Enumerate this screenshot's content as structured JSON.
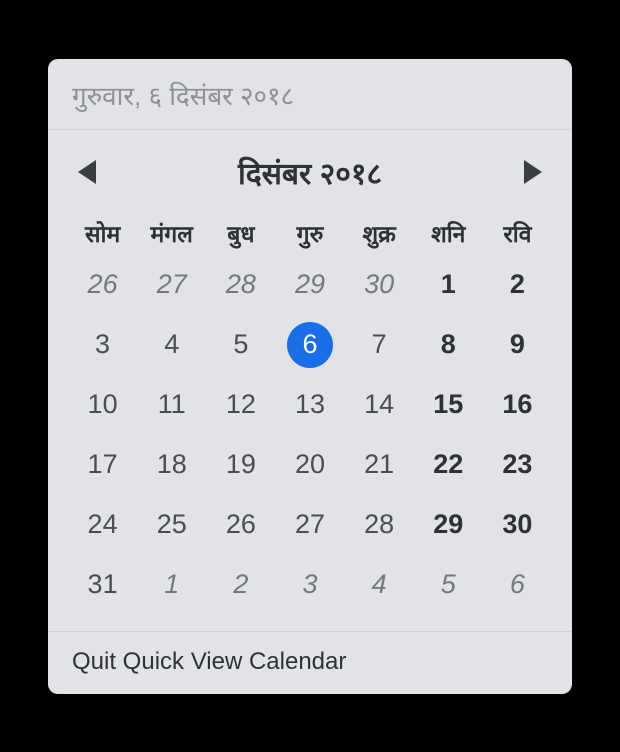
{
  "header": {
    "full_date": "गुरुवार, ६ दिसंबर २०१८"
  },
  "nav": {
    "month_year": "दिसंबर २०१८"
  },
  "weekdays": [
    "सोम",
    "मंगल",
    "बुध",
    "गुरु",
    "शुक्र",
    "शनि",
    "रवि"
  ],
  "days": [
    {
      "n": "26",
      "other": true,
      "weekend": false,
      "today": false
    },
    {
      "n": "27",
      "other": true,
      "weekend": false,
      "today": false
    },
    {
      "n": "28",
      "other": true,
      "weekend": false,
      "today": false
    },
    {
      "n": "29",
      "other": true,
      "weekend": false,
      "today": false
    },
    {
      "n": "30",
      "other": true,
      "weekend": false,
      "today": false
    },
    {
      "n": "1",
      "other": false,
      "weekend": true,
      "today": false
    },
    {
      "n": "2",
      "other": false,
      "weekend": true,
      "today": false
    },
    {
      "n": "3",
      "other": false,
      "weekend": false,
      "today": false
    },
    {
      "n": "4",
      "other": false,
      "weekend": false,
      "today": false
    },
    {
      "n": "5",
      "other": false,
      "weekend": false,
      "today": false
    },
    {
      "n": "6",
      "other": false,
      "weekend": false,
      "today": true
    },
    {
      "n": "7",
      "other": false,
      "weekend": false,
      "today": false
    },
    {
      "n": "8",
      "other": false,
      "weekend": true,
      "today": false
    },
    {
      "n": "9",
      "other": false,
      "weekend": true,
      "today": false
    },
    {
      "n": "10",
      "other": false,
      "weekend": false,
      "today": false
    },
    {
      "n": "11",
      "other": false,
      "weekend": false,
      "today": false
    },
    {
      "n": "12",
      "other": false,
      "weekend": false,
      "today": false
    },
    {
      "n": "13",
      "other": false,
      "weekend": false,
      "today": false
    },
    {
      "n": "14",
      "other": false,
      "weekend": false,
      "today": false
    },
    {
      "n": "15",
      "other": false,
      "weekend": true,
      "today": false
    },
    {
      "n": "16",
      "other": false,
      "weekend": true,
      "today": false
    },
    {
      "n": "17",
      "other": false,
      "weekend": false,
      "today": false
    },
    {
      "n": "18",
      "other": false,
      "weekend": false,
      "today": false
    },
    {
      "n": "19",
      "other": false,
      "weekend": false,
      "today": false
    },
    {
      "n": "20",
      "other": false,
      "weekend": false,
      "today": false
    },
    {
      "n": "21",
      "other": false,
      "weekend": false,
      "today": false
    },
    {
      "n": "22",
      "other": false,
      "weekend": true,
      "today": false
    },
    {
      "n": "23",
      "other": false,
      "weekend": true,
      "today": false
    },
    {
      "n": "24",
      "other": false,
      "weekend": false,
      "today": false
    },
    {
      "n": "25",
      "other": false,
      "weekend": false,
      "today": false
    },
    {
      "n": "26",
      "other": false,
      "weekend": false,
      "today": false
    },
    {
      "n": "27",
      "other": false,
      "weekend": false,
      "today": false
    },
    {
      "n": "28",
      "other": false,
      "weekend": false,
      "today": false
    },
    {
      "n": "29",
      "other": false,
      "weekend": true,
      "today": false
    },
    {
      "n": "30",
      "other": false,
      "weekend": true,
      "today": false
    },
    {
      "n": "31",
      "other": false,
      "weekend": false,
      "today": false
    },
    {
      "n": "1",
      "other": true,
      "weekend": false,
      "today": false
    },
    {
      "n": "2",
      "other": true,
      "weekend": false,
      "today": false
    },
    {
      "n": "3",
      "other": true,
      "weekend": false,
      "today": false
    },
    {
      "n": "4",
      "other": true,
      "weekend": false,
      "today": false
    },
    {
      "n": "5",
      "other": true,
      "weekend": true,
      "today": false
    },
    {
      "n": "6",
      "other": true,
      "weekend": true,
      "today": false
    }
  ],
  "footer": {
    "quit_label": "Quit Quick View Calendar"
  },
  "colors": {
    "today_bg": "#1a6fe8",
    "popup_bg": "#e1e3e6"
  }
}
